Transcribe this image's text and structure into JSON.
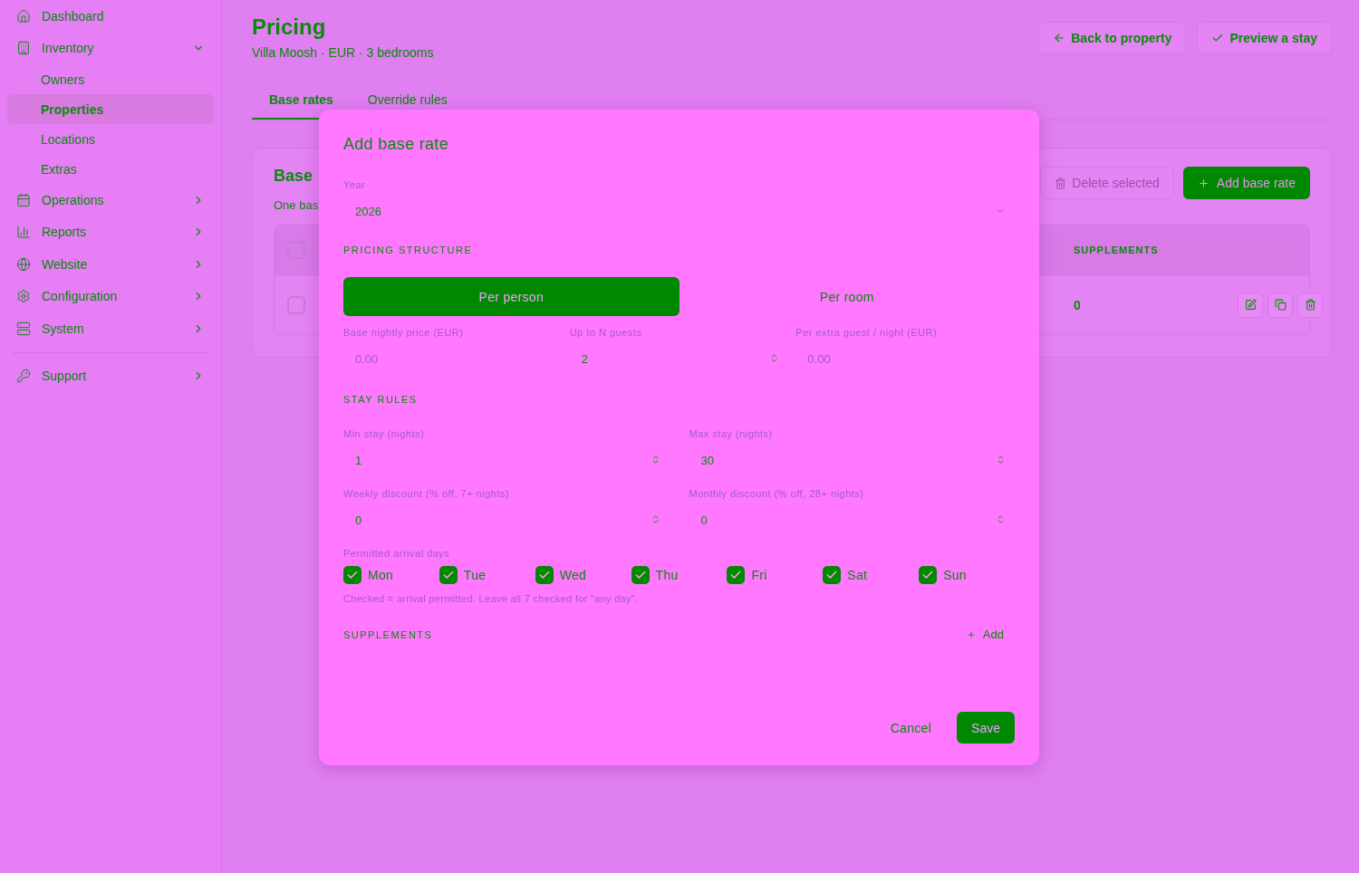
{
  "sidebar": {
    "items": [
      {
        "label": "Dashboard",
        "selected": false
      },
      {
        "label": "Inventory",
        "selected": false,
        "expanded": true,
        "children": [
          {
            "label": "Owners",
            "selected": false
          },
          {
            "label": "Properties",
            "selected": true
          },
          {
            "label": "Locations",
            "selected": false
          },
          {
            "label": "Extras",
            "selected": false
          }
        ]
      },
      {
        "label": "Operations",
        "selected": false,
        "expanded": false
      },
      {
        "label": "Reports",
        "selected": false,
        "expanded": false
      },
      {
        "label": "Website",
        "selected": false,
        "expanded": false
      },
      {
        "label": "Configuration",
        "selected": false,
        "expanded": false
      },
      {
        "label": "System",
        "selected": false,
        "expanded": false
      }
    ],
    "footer_items": [
      {
        "label": "Support",
        "selected": false,
        "expanded": false
      }
    ]
  },
  "page": {
    "title": "Pricing",
    "subtitle": "Villa Moosh · EUR · 3 bedrooms",
    "actions": [
      "Back to property",
      "Preview a stay"
    ],
    "tabs": [
      {
        "label": "Base rates",
        "selected": true
      },
      {
        "label": "Override rules",
        "selected": false
      }
    ],
    "card": {
      "title": "Base",
      "subtitle": "One bas",
      "delete_button": "Delete selected",
      "add_button": "Add base rate",
      "table": {
        "header_checked": false,
        "columns": [
          "SUPPLEMENTS"
        ],
        "rows": [
          {
            "checked": false,
            "supplements": "0"
          }
        ]
      }
    }
  },
  "dialog": {
    "title": "Add base rate",
    "year": {
      "label": "Year",
      "value": "2026"
    },
    "pricing_heading": "PRICING STRUCTURE",
    "pricing_options": [
      {
        "label": "Per person",
        "selected": true
      },
      {
        "label": "Per room",
        "selected": false
      }
    ],
    "price_fields": [
      {
        "label": "Base nightly price (EUR)",
        "kind": "plain",
        "placeholder": "0.00"
      },
      {
        "label": "Up to N guests",
        "kind": "stepper",
        "value": "2"
      },
      {
        "label": "Per extra guest / night (EUR)",
        "kind": "plain",
        "placeholder": "0.00"
      }
    ],
    "stay_heading": "STAY RULES",
    "stay_fields": [
      {
        "label": "Min stay (nights)",
        "kind": "stepper",
        "value": "1"
      },
      {
        "label": "Max stay (nights)",
        "kind": "stepper",
        "value": "30"
      },
      {
        "label": "Weekly discount (% off, 7+ nights)",
        "kind": "stepper",
        "value": "0"
      },
      {
        "label": "Monthly discount (% off, 28+ nights)",
        "kind": "stepper",
        "value": "0"
      }
    ],
    "days_label": "Permitted arrival days",
    "days": [
      {
        "label": "Mon",
        "checked": true
      },
      {
        "label": "Tue",
        "checked": true
      },
      {
        "label": "Wed",
        "checked": true
      },
      {
        "label": "Thu",
        "checked": true
      },
      {
        "label": "Fri",
        "checked": true
      },
      {
        "label": "Sat",
        "checked": true
      },
      {
        "label": "Sun",
        "checked": true
      }
    ],
    "days_hint": "Checked = arrival permitted. Leave all 7 checked for \"any day\".",
    "supplements_heading": "SUPPLEMENTS",
    "add_supplement": "Add",
    "cancel": "Cancel",
    "save": "Save"
  }
}
